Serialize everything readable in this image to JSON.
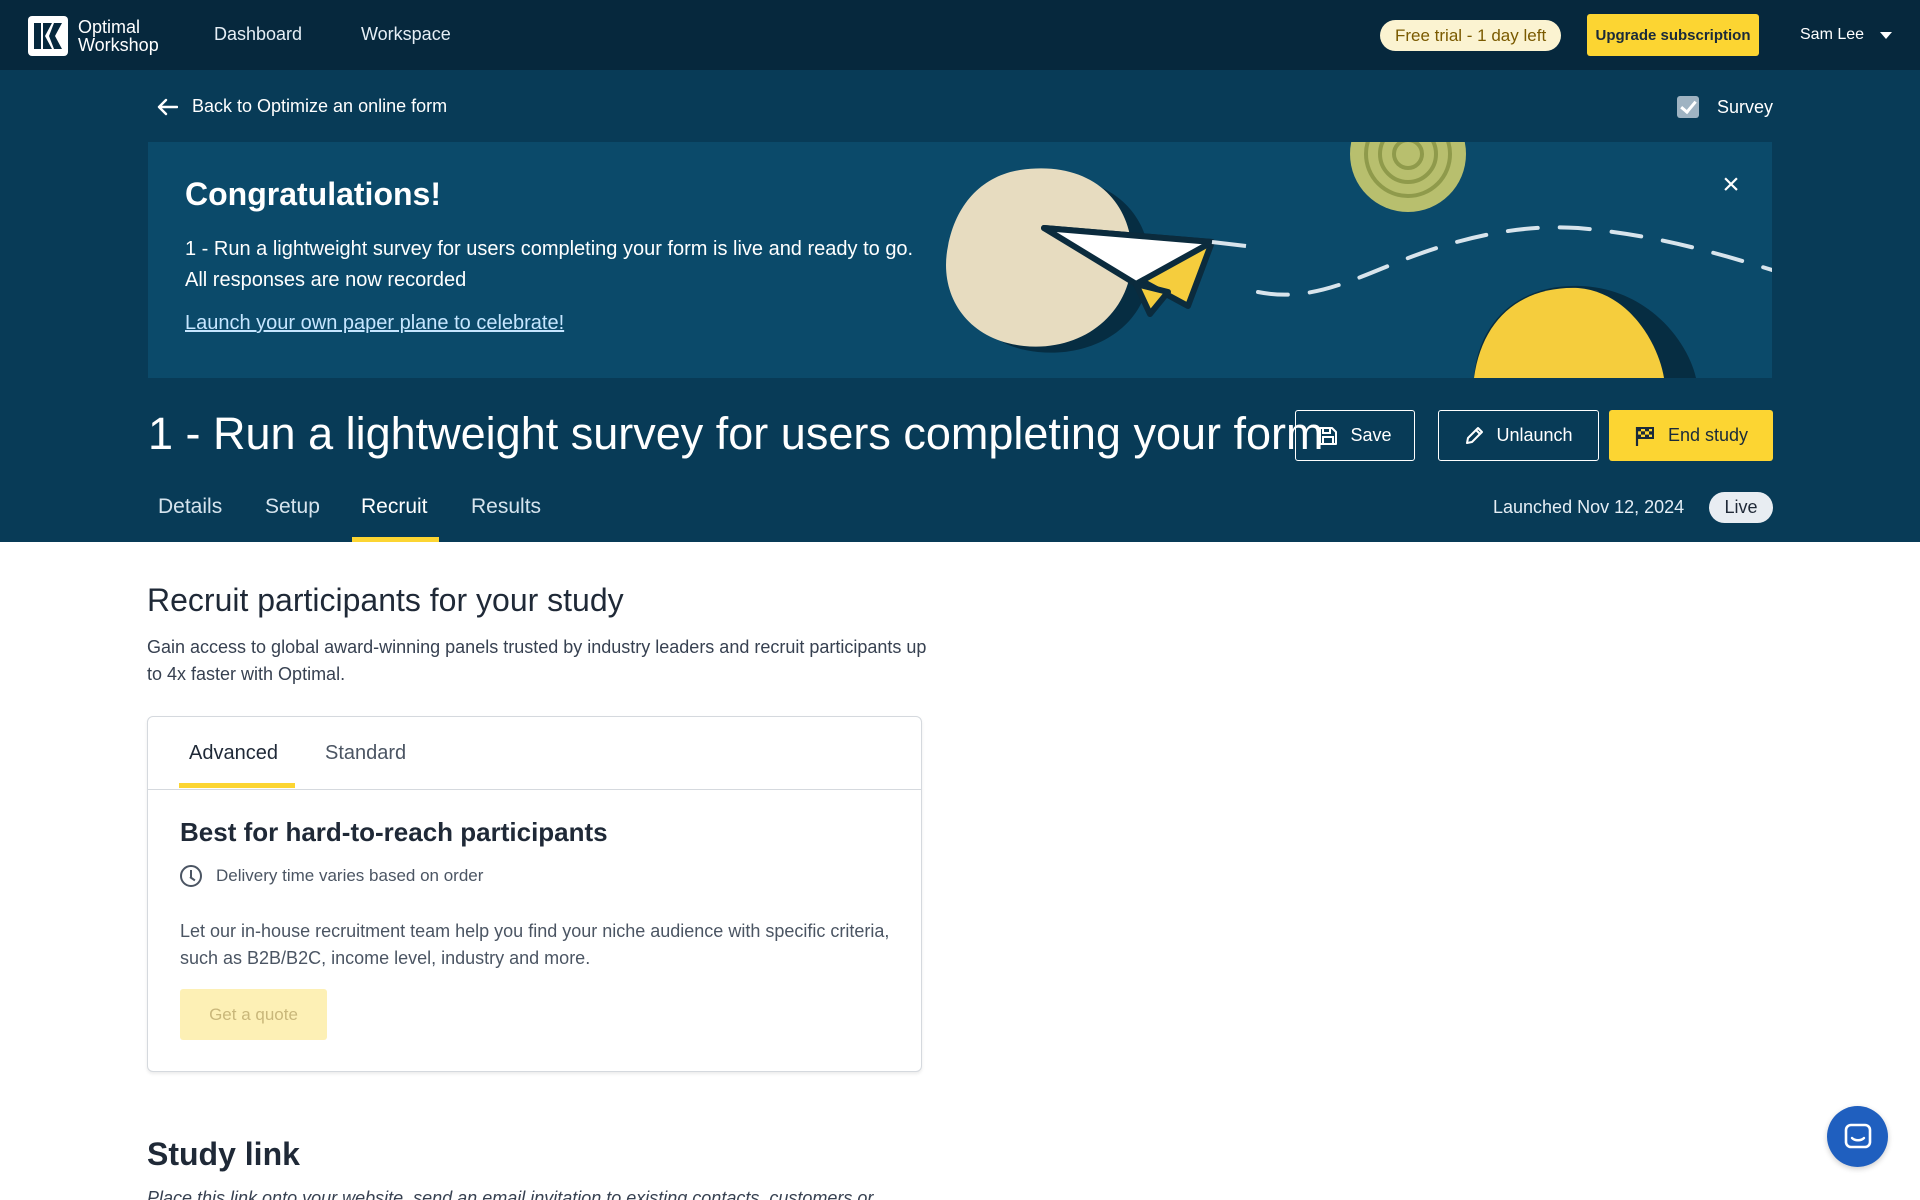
{
  "topnav": {
    "brand_line1": "Optimal",
    "brand_line2": "Workshop",
    "links": [
      "Dashboard",
      "Workspace"
    ],
    "trial_badge": "Free trial - 1 day left",
    "upgrade_label": "Upgrade subscription",
    "user_name": "Sam Lee"
  },
  "header": {
    "back_label": "Back to Optimize an online form",
    "study_type": "Survey",
    "banner": {
      "title": "Congratulations!",
      "line1": "1 - Run a lightweight survey for users completing your form is live and ready to go.",
      "line2": "All responses are now recorded",
      "link": "Launch your own paper plane to celebrate!"
    },
    "study_title": "1 - Run a lightweight survey for users completing your form",
    "buttons": {
      "save": "Save",
      "unlaunch": "Unlaunch",
      "end": "End study"
    },
    "tabs": [
      "Details",
      "Setup",
      "Recruit",
      "Results"
    ],
    "active_tab": "Recruit",
    "launched": "Launched Nov 12, 2024",
    "status": "Live"
  },
  "main": {
    "recruit_heading": "Recruit participants for your study",
    "recruit_desc": "Gain access to global award-winning panels trusted by industry leaders and recruit participants up to 4x faster with Optimal.",
    "card": {
      "tabs": [
        "Advanced",
        "Standard"
      ],
      "active_tab": "Advanced",
      "heading": "Best for hard-to-reach participants",
      "delivery": "Delivery time varies based on order",
      "body": "Let our in-house recruitment team help you find your niche audience with specific criteria, such as B2B/B2C, income level, industry and more.",
      "quote_button": "Get a quote"
    },
    "study_link_heading": "Study link",
    "study_link_desc": "Place this link onto your website, send an email invitation to existing contacts, customers or"
  },
  "colors": {
    "nav_bg": "#06283d",
    "header_bg": "#083b57",
    "banner_bg": "#0b4a6a",
    "accent_yellow": "#fcd532",
    "chat_blue": "#1f5fbf"
  },
  "icons": [
    "logo-icon",
    "arrow-left-icon",
    "checkbox-icon",
    "close-icon",
    "save-icon",
    "pencil-icon",
    "flag-icon",
    "clock-icon",
    "chat-icon",
    "chevron-down-icon"
  ]
}
